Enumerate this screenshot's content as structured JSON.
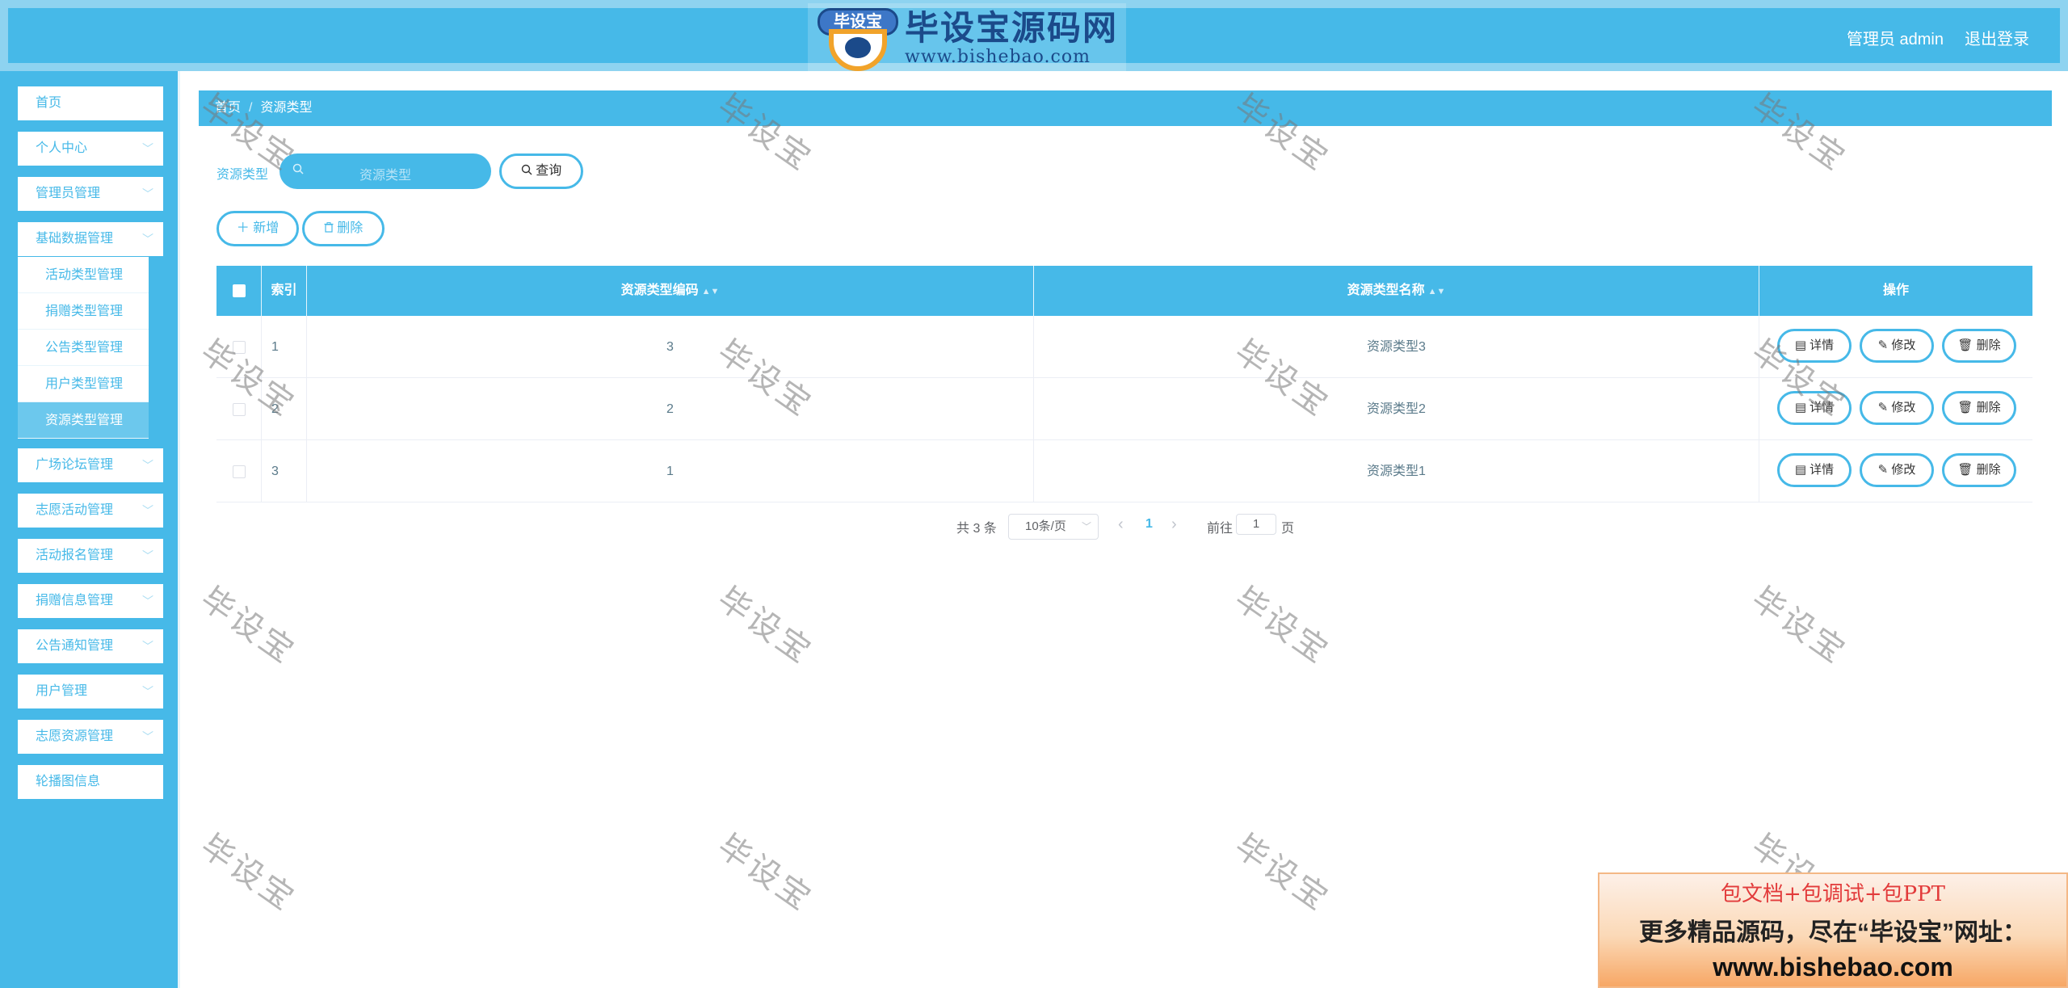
{
  "header": {
    "logo_badge": "毕设宝",
    "logo_title": "毕设宝源码网",
    "logo_url": "www.bishebao.com",
    "user": "管理员 admin",
    "logout": "退出登录"
  },
  "sidebar": {
    "items": [
      {
        "label": "首页"
      },
      {
        "label": "个人中心"
      },
      {
        "label": "管理员管理"
      },
      {
        "label": "基础数据管理"
      },
      {
        "label": "广场论坛管理"
      },
      {
        "label": "志愿活动管理"
      },
      {
        "label": "活动报名管理"
      },
      {
        "label": "捐赠信息管理"
      },
      {
        "label": "公告通知管理"
      },
      {
        "label": "用户管理"
      },
      {
        "label": "志愿资源管理"
      },
      {
        "label": "轮播图信息"
      }
    ],
    "submenu": [
      {
        "label": "活动类型管理"
      },
      {
        "label": "捐赠类型管理"
      },
      {
        "label": "公告类型管理"
      },
      {
        "label": "用户类型管理"
      },
      {
        "label": "资源类型管理"
      }
    ],
    "chevron": "﹀"
  },
  "breadcrumb": {
    "home": "首页",
    "separator": "/",
    "current": "资源类型"
  },
  "search": {
    "label": "资源类型",
    "placeholder": "资源类型",
    "query_label": "查询"
  },
  "toolbar": {
    "add_label": "新增",
    "delete_label": "删除"
  },
  "table": {
    "headers": {
      "index": "索引",
      "code": "资源类型编码",
      "name": "资源类型名称",
      "actions": "操作"
    },
    "rows": [
      {
        "index": "1",
        "code": "3",
        "name": "资源类型3"
      },
      {
        "index": "2",
        "code": "2",
        "name": "资源类型2"
      },
      {
        "index": "3",
        "code": "1",
        "name": "资源类型1"
      }
    ],
    "actions": {
      "detail": "详情",
      "edit": "修改",
      "delete": "删除"
    }
  },
  "pagination": {
    "total": "共 3 条",
    "page_size": "10条/页",
    "prev": "‹",
    "current_page": "1",
    "next": "›",
    "goto_prefix": "前往",
    "goto_value": "1",
    "goto_suffix": "页"
  },
  "watermark": "毕设宝",
  "promo": {
    "line1": "包文档+包调试+包PPT",
    "line2": "更多精品源码，尽在“毕设宝”网址：",
    "line3": "www.bishebao.com"
  },
  "colors": {
    "primary": "#46b9e8",
    "header_outer": "#8ed3f0",
    "active_submenu": "#6cc8ed",
    "promo_red": "#e23b3b"
  }
}
